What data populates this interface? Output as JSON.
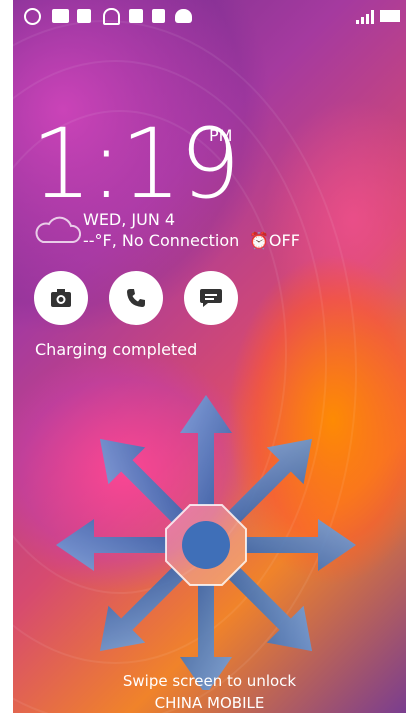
{
  "clock": {
    "time": "1:19",
    "ampm": "PM"
  },
  "weather": {
    "date": "WED, JUN 4",
    "condition": "--°F, No Connection",
    "alarm": "OFF"
  },
  "shortcuts": [
    {
      "name": "camera",
      "icon": "camera-icon"
    },
    {
      "name": "phone",
      "icon": "phone-icon"
    },
    {
      "name": "messages",
      "icon": "message-icon"
    }
  ],
  "charging_status": "Charging completed",
  "unlock_hint": "Swipe screen to unlock",
  "carrier": "CHINA MOBILE",
  "colors": {
    "accent": "#3f78c0",
    "arrow": "#4a82c8"
  }
}
